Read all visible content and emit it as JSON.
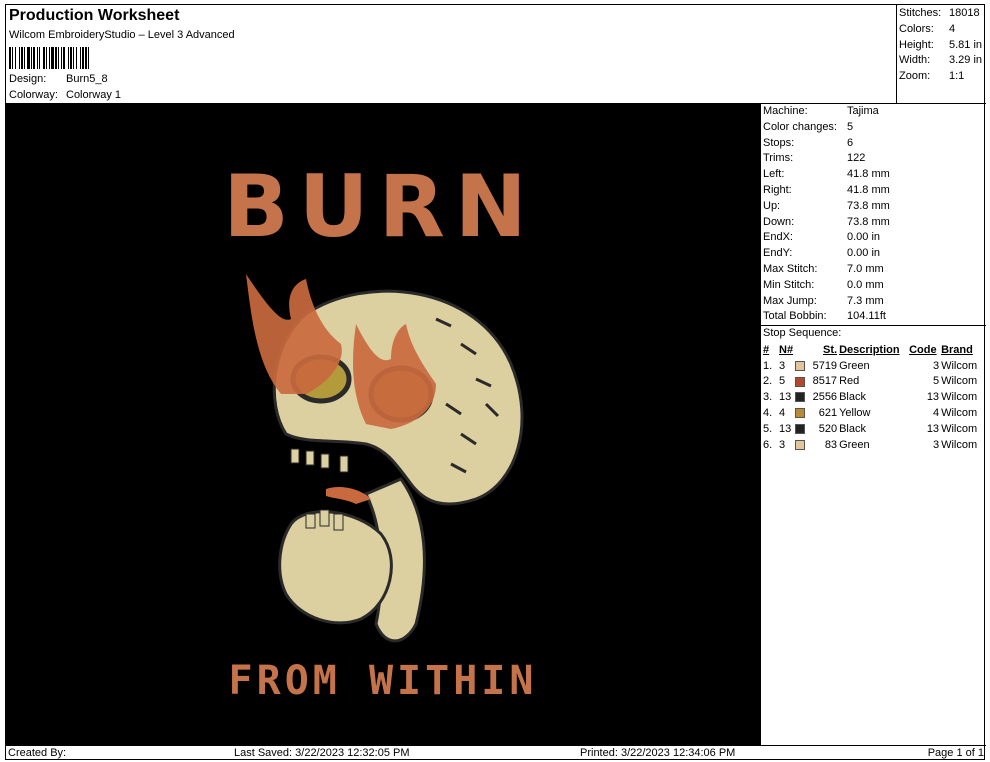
{
  "header": {
    "title": "Production Worksheet",
    "subtitle": "Wilcom EmbroideryStudio – Level 3 Advanced",
    "design_label": "Design:",
    "design_value": "Burn5_8",
    "colorway_label": "Colorway:",
    "colorway_value": "Colorway 1"
  },
  "summary": [
    {
      "label": "Stitches:",
      "value": "18018"
    },
    {
      "label": "Colors:",
      "value": "4"
    },
    {
      "label": "Height:",
      "value": "5.81 in"
    },
    {
      "label": "Width:",
      "value": "3.29 in"
    },
    {
      "label": "Zoom:",
      "value": "1:1"
    }
  ],
  "artwork": {
    "title_text": "BURN",
    "bottom_text": "FROM WITHIN",
    "colors": {
      "background": "#000000",
      "letters": "#c4734a",
      "bone": "#dcd0a0",
      "flame": "#c9693e",
      "eye": "#b39a3a",
      "outline": "#2a2a2a"
    }
  },
  "machine_info": [
    {
      "label": "Machine:",
      "value": "Tajima"
    },
    {
      "label": "Color changes:",
      "value": "5"
    },
    {
      "label": "Stops:",
      "value": "6"
    },
    {
      "label": "Trims:",
      "value": "122"
    },
    {
      "label": "Left:",
      "value": "41.8 mm"
    },
    {
      "label": "Right:",
      "value": "41.8 mm"
    },
    {
      "label": "Up:",
      "value": "73.8 mm"
    },
    {
      "label": "Down:",
      "value": "73.8 mm"
    },
    {
      "label": "EndX:",
      "value": "0.00 in"
    },
    {
      "label": "EndY:",
      "value": "0.00 in"
    },
    {
      "label": "Max Stitch:",
      "value": "7.0 mm"
    },
    {
      "label": "Min Stitch:",
      "value": "0.0 mm"
    },
    {
      "label": "Max Jump:",
      "value": "7.3 mm"
    },
    {
      "label": "Total Bobbin:",
      "value": "104.11ft"
    }
  ],
  "stop_sequence": {
    "title": "Stop Sequence:",
    "headers": {
      "index": "#",
      "needle": "N#",
      "stitches": "St.",
      "description": "Description",
      "code": "Code",
      "brand": "Brand"
    },
    "rows": [
      {
        "index": "1.",
        "needle": "3",
        "color": "#e3c49a",
        "stitches": "5719",
        "description": "Green",
        "code": "3",
        "brand": "Wilcom"
      },
      {
        "index": "2.",
        "needle": "5",
        "color": "#b5482a",
        "stitches": "8517",
        "description": "Red",
        "code": "5",
        "brand": "Wilcom"
      },
      {
        "index": "3.",
        "needle": "13",
        "color": "#222222",
        "stitches": "2556",
        "description": "Black",
        "code": "13",
        "brand": "Wilcom"
      },
      {
        "index": "4.",
        "needle": "4",
        "color": "#b8893a",
        "stitches": "621",
        "description": "Yellow",
        "code": "4",
        "brand": "Wilcom"
      },
      {
        "index": "5.",
        "needle": "13",
        "color": "#222222",
        "stitches": "520",
        "description": "Black",
        "code": "13",
        "brand": "Wilcom"
      },
      {
        "index": "6.",
        "needle": "3",
        "color": "#e3c49a",
        "stitches": "83",
        "description": "Green",
        "code": "3",
        "brand": "Wilcom"
      }
    ]
  },
  "footer": {
    "created_by": "Created By:",
    "last_saved": "Last Saved: 3/22/2023 12:32:05 PM",
    "printed": "Printed: 3/22/2023 12:34:06 PM",
    "page": "Page 1 of 1"
  }
}
